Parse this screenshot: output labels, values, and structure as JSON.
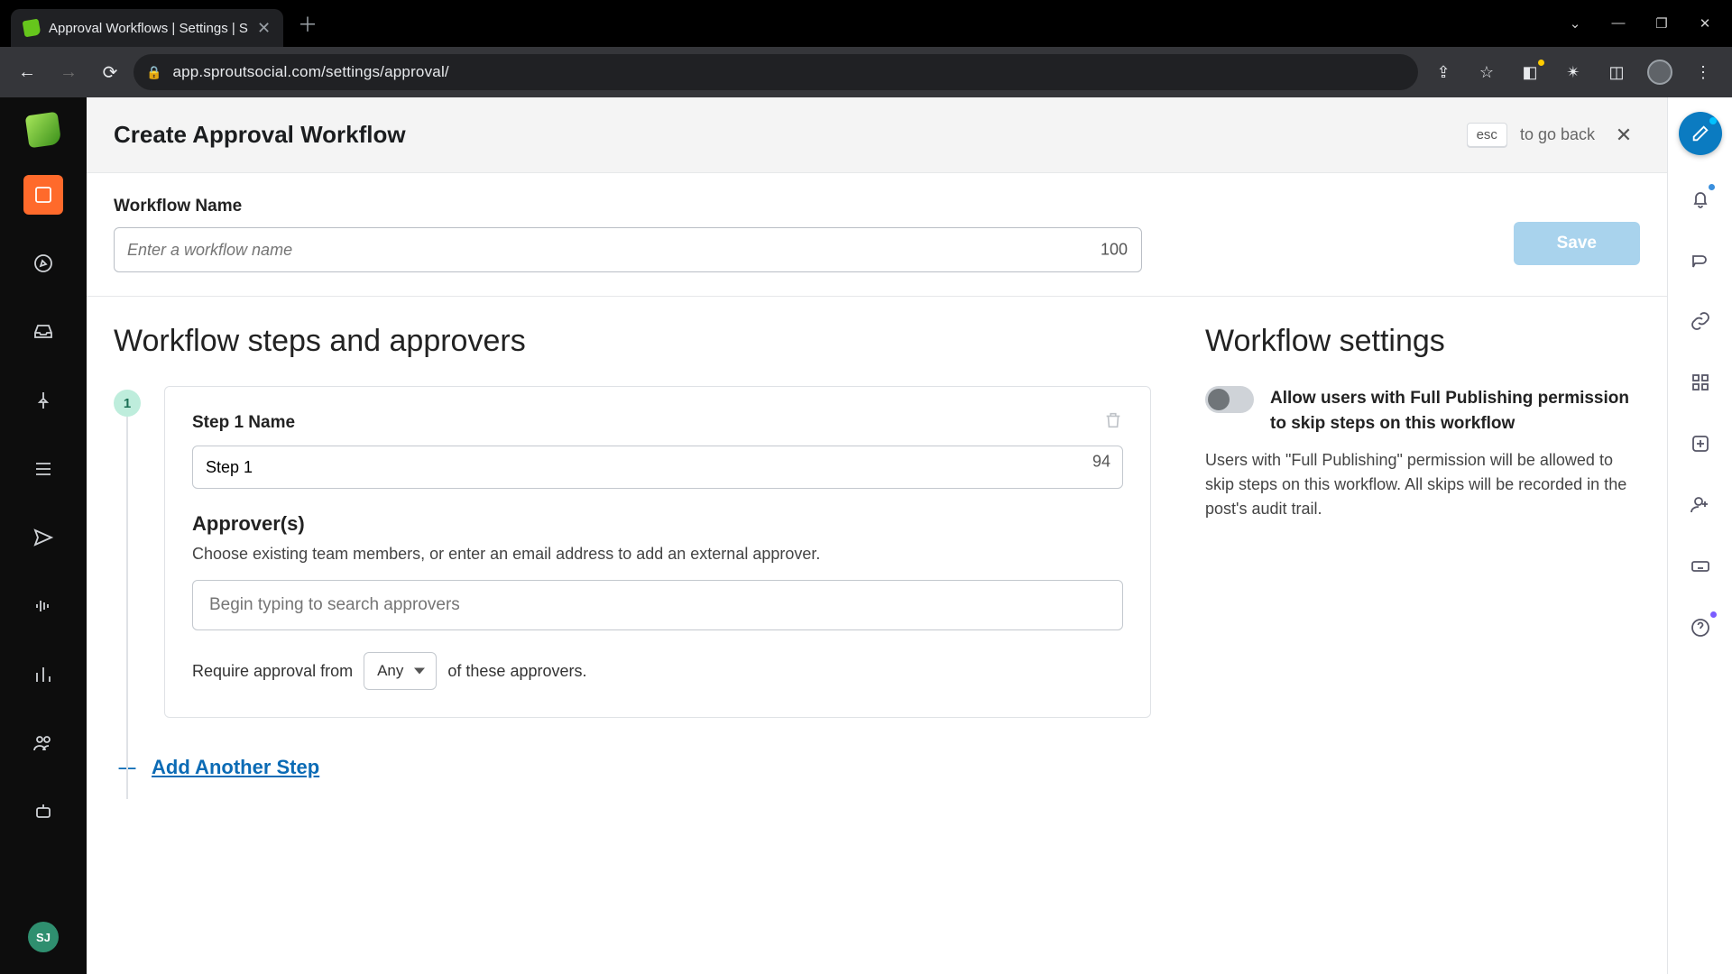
{
  "browser": {
    "tab_title": "Approval Workflows | Settings | S",
    "url": "app.sproutsocial.com/settings/approval/"
  },
  "header": {
    "title": "Create Approval Workflow",
    "esc_key": "esc",
    "go_back": "to go back"
  },
  "workflow_name": {
    "label": "Workflow Name",
    "placeholder": "Enter a workflow name",
    "value": "",
    "char_limit": "100"
  },
  "save_button": "Save",
  "steps_section_title": "Workflow steps and approvers",
  "step": {
    "number": "1",
    "name_label": "Step 1 Name",
    "name_value": "Step 1",
    "name_remaining": "94",
    "approvers_heading": "Approver(s)",
    "approvers_help": "Choose existing team members, or enter an email address to add an external approver.",
    "approvers_placeholder": "Begin typing to search approvers",
    "require_prefix": "Require approval from",
    "require_select": "Any",
    "require_suffix": "of these approvers."
  },
  "add_step": "Add Another Step",
  "settings": {
    "title": "Workflow settings",
    "toggle_label": "Allow users with Full Publishing permission to skip steps on this workflow",
    "toggle_desc": "Users with \"Full Publishing\" permission will be allowed to skip steps on this workflow. All skips will be recorded in the post's audit trail."
  },
  "user_initials": "SJ"
}
